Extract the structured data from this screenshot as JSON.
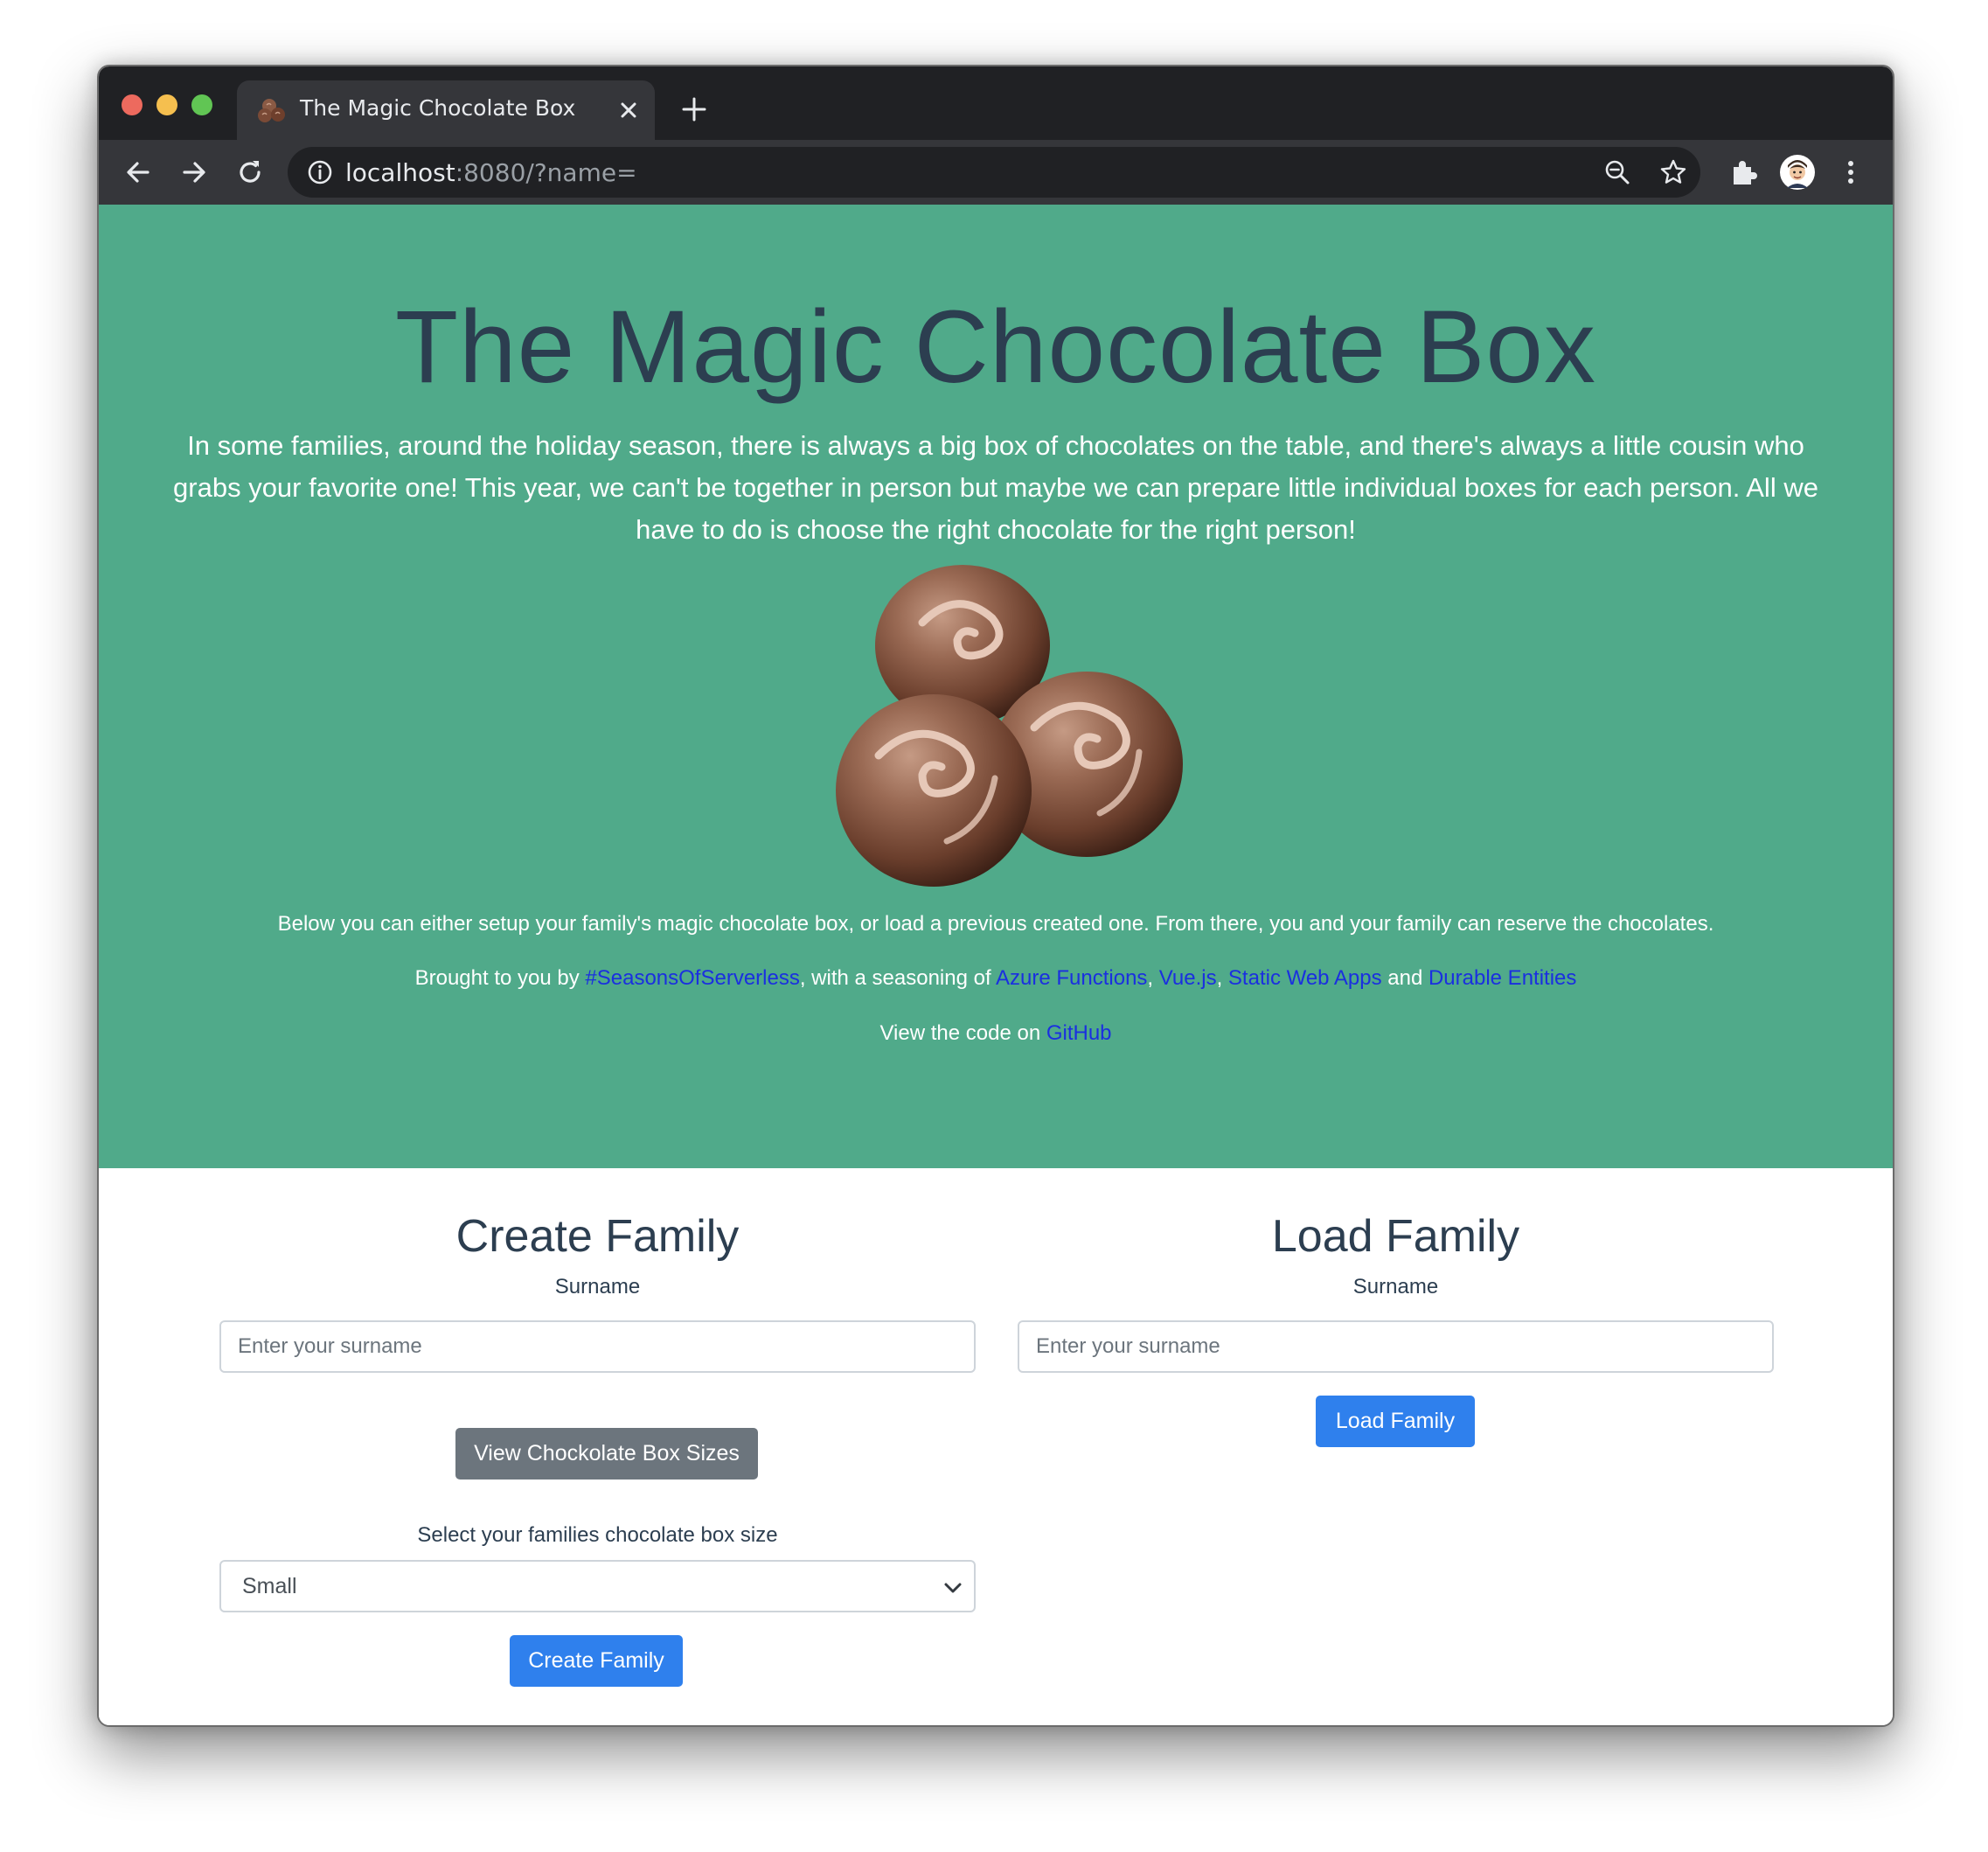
{
  "browser": {
    "tab_title": "The Magic Chocolate Box",
    "url_host": "localhost",
    "url_rest": ":8080/?name=",
    "icons": [
      "back-arrow-icon",
      "forward-arrow-icon",
      "reload-icon",
      "info-icon",
      "zoom-out-icon",
      "bookmark-star-icon",
      "extensions-puzzle-icon",
      "profile-avatar",
      "more-menu-icon",
      "new-tab-plus-icon",
      "tab-close-icon"
    ]
  },
  "hero": {
    "title": "The Magic Chocolate Box",
    "lead": "In some families, around the holiday season, there is always a big box of chocolates on the table, and there's always a little cousin who grabs your favorite one! This year, we can't be together in person but maybe we can prepare little individual boxes for each person. All we have to do is choose the right chocolate for the right person!",
    "intro": "Below you can either setup your family's magic chocolate box, or load a previous created one. From there, you and your family can reserve the chocolates.",
    "brought_prefix": "Brought to you by ",
    "link_seasons": "#SeasonsOfServerless",
    "brought_mid": ", with a seasoning of ",
    "link_functions": "Azure Functions",
    "sep1": ", ",
    "link_vue": "Vue.js",
    "sep2": ", ",
    "link_swa": "Static Web Apps",
    "sep3": " and ",
    "link_durable": "Durable Entities",
    "code_prefix": "View the code on ",
    "link_github": "GitHub"
  },
  "create": {
    "title": "Create Family",
    "surname_label": "Surname",
    "surname_placeholder": "Enter your surname",
    "view_sizes_button": "View Chockolate Box Sizes",
    "size_label": "Select your families chocolate box size",
    "size_selected": "Small",
    "create_button": "Create Family"
  },
  "load": {
    "title": "Load Family",
    "surname_label": "Surname",
    "surname_placeholder": "Enter your surname",
    "load_button": "Load Family"
  },
  "colors": {
    "hero_bg": "#50aa8a",
    "heading": "#2c3e50",
    "link": "#1a2fe0",
    "primary_button": "#2f80ed",
    "secondary_button": "#6c757d"
  }
}
